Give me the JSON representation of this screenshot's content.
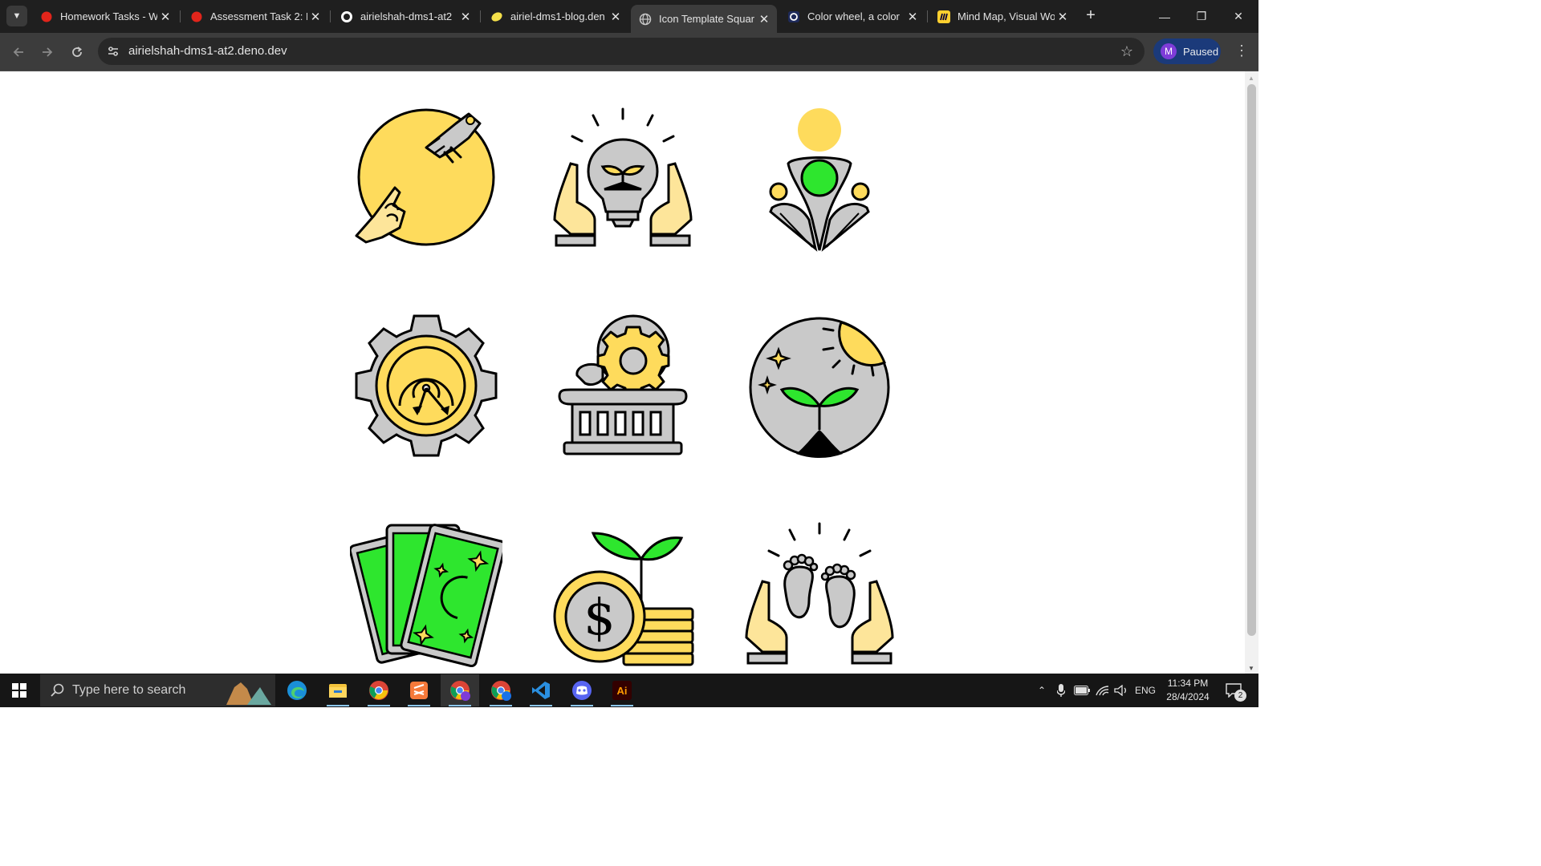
{
  "browser": {
    "tabs": [
      {
        "title": "Homework Tasks - W",
        "icon": "red-app-icon"
      },
      {
        "title": "Assessment Task 2: D",
        "icon": "red-app-icon"
      },
      {
        "title": "airielshah-dms1-at2",
        "icon": "github-icon"
      },
      {
        "title": "airiel-dms1-blog.den",
        "icon": "deno-icon"
      },
      {
        "title": "Icon Template Squar",
        "icon": "globe-icon",
        "active": true
      },
      {
        "title": "Color wheel, a color",
        "icon": "color-wheel-icon"
      },
      {
        "title": "Mind Map, Visual Wo",
        "icon": "miro-icon"
      }
    ],
    "url": "airielshah-dms1-at2.deno.dev",
    "profile": {
      "initial": "M",
      "label": "Paused"
    }
  },
  "page": {
    "icons": [
      {
        "name": "human-robot-touch-icon"
      },
      {
        "name": "hands-lightbulb-sprout-icon"
      },
      {
        "name": "person-community-icon"
      },
      {
        "name": "gear-target-icon"
      },
      {
        "name": "lightbulb-gear-pillar-icon"
      },
      {
        "name": "moon-sun-sprout-icon"
      },
      {
        "name": "tarot-cards-icon"
      },
      {
        "name": "coin-plant-icon"
      },
      {
        "name": "hands-baby-feet-icon"
      }
    ],
    "palette": {
      "yellow": "#fedb5c",
      "green": "#2ee62e",
      "grey": "#c9c9c9",
      "skin": "#fde59a",
      "outline": "#000000"
    }
  },
  "taskbar": {
    "search_placeholder": "Type here to search",
    "apps": [
      "edge-icon",
      "file-explorer-icon",
      "chrome-icon",
      "sublime-icon",
      "chrome-profile-icon",
      "chrome-alt-icon",
      "vscode-icon",
      "discord-icon",
      "illustrator-icon"
    ],
    "illustrator_label": "Ai",
    "language": "ENG",
    "time": "11:34 PM",
    "date": "28/4/2024",
    "notification_count": "2"
  }
}
